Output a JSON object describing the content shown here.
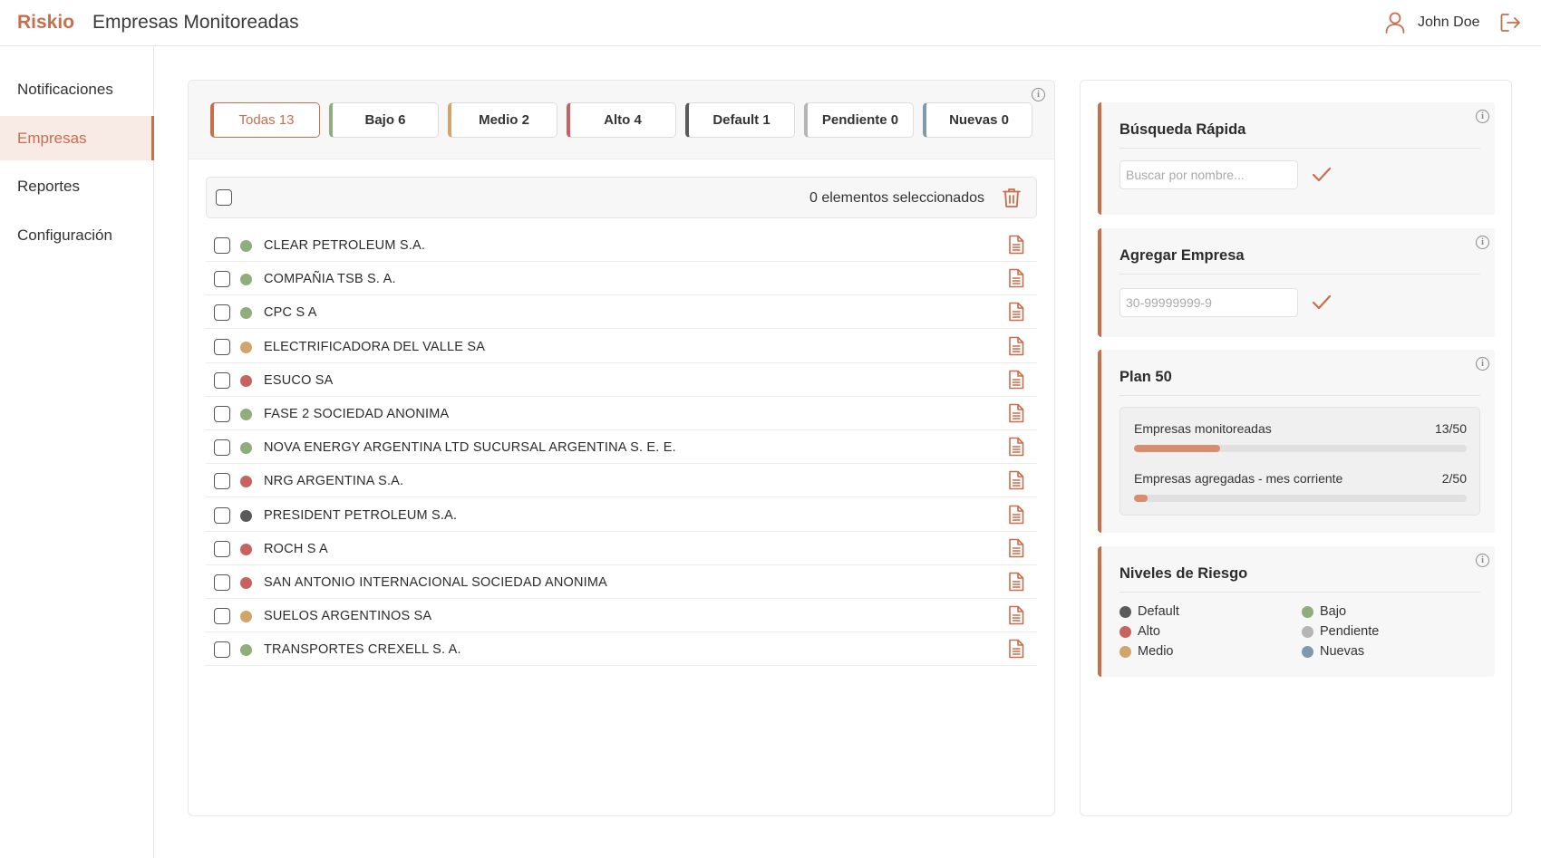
{
  "header": {
    "logo": "Riskio",
    "title": "Empresas Monitoreadas",
    "user_name": "John Doe",
    "user_icon": "user-icon",
    "logout_icon": "logout-icon"
  },
  "sidebar": {
    "items": [
      {
        "label": "Notificaciones",
        "active": false
      },
      {
        "label": "Empresas",
        "active": true
      },
      {
        "label": "Reportes",
        "active": false
      },
      {
        "label": "Configuración",
        "active": false
      }
    ]
  },
  "colors": {
    "accent": "#c96e4b",
    "bajo": "#8fae7c",
    "medio": "#d1a46a",
    "alto": "#c8625f",
    "default": "#5a5a5a",
    "pendiente": "#b5b5b5",
    "nuevas": "#7f98ae"
  },
  "filters": [
    {
      "label": "Todas 13",
      "key": "todas",
      "active": true,
      "color": "#c96e4b"
    },
    {
      "label": "Bajo 6",
      "key": "bajo",
      "active": false,
      "color": "#8fae7c"
    },
    {
      "label": "Medio 2",
      "key": "medio",
      "active": false,
      "color": "#d1a46a"
    },
    {
      "label": "Alto 4",
      "key": "alto",
      "active": false,
      "color": "#c8625f"
    },
    {
      "label": "Default 1",
      "key": "default",
      "active": false,
      "color": "#5a5a5a"
    },
    {
      "label": "Pendiente 0",
      "key": "pendiente",
      "active": false,
      "color": "#b5b5b5"
    },
    {
      "label": "Nuevas 0",
      "key": "nuevas",
      "active": false,
      "color": "#7f98ae"
    }
  ],
  "selection": {
    "text": "0 elementos seleccionados"
  },
  "companies": [
    {
      "name": "CLEAR PETROLEUM S.A.",
      "risk": "bajo"
    },
    {
      "name": "COMPAÑIA TSB S. A.",
      "risk": "bajo"
    },
    {
      "name": "CPC S A",
      "risk": "bajo"
    },
    {
      "name": "ELECTRIFICADORA DEL VALLE SA",
      "risk": "medio"
    },
    {
      "name": "ESUCO SA",
      "risk": "alto"
    },
    {
      "name": "FASE 2 SOCIEDAD ANONIMA",
      "risk": "bajo"
    },
    {
      "name": "NOVA ENERGY ARGENTINA LTD SUCURSAL ARGENTINA S. E. E.",
      "risk": "bajo"
    },
    {
      "name": "NRG ARGENTINA S.A.",
      "risk": "alto"
    },
    {
      "name": "PRESIDENT PETROLEUM S.A.",
      "risk": "default"
    },
    {
      "name": "ROCH S A",
      "risk": "alto"
    },
    {
      "name": "SAN ANTONIO INTERNACIONAL SOCIEDAD ANONIMA",
      "risk": "alto"
    },
    {
      "name": "SUELOS ARGENTINOS SA",
      "risk": "medio"
    },
    {
      "name": "TRANSPORTES CREXELL S. A.",
      "risk": "bajo"
    }
  ],
  "quick_search": {
    "title": "Búsqueda Rápida",
    "placeholder": "Buscar por nombre...",
    "value": ""
  },
  "add_company": {
    "title": "Agregar Empresa",
    "placeholder": "30-99999999-9",
    "value": ""
  },
  "plan": {
    "title": "Plan 50",
    "monitored_label": "Empresas monitoreadas",
    "monitored_value": "13/50",
    "monitored_fraction": 0.26,
    "added_label": "Empresas agregadas - mes corriente",
    "added_value": "2/50",
    "added_fraction": 0.04
  },
  "risk_levels": {
    "title": "Niveles de Riesgo",
    "items": [
      {
        "label": "Default",
        "key": "default"
      },
      {
        "label": "Bajo",
        "key": "bajo"
      },
      {
        "label": "Alto",
        "key": "alto"
      },
      {
        "label": "Pendiente",
        "key": "pendiente"
      },
      {
        "label": "Medio",
        "key": "medio"
      },
      {
        "label": "Nuevas",
        "key": "nuevas"
      }
    ]
  }
}
